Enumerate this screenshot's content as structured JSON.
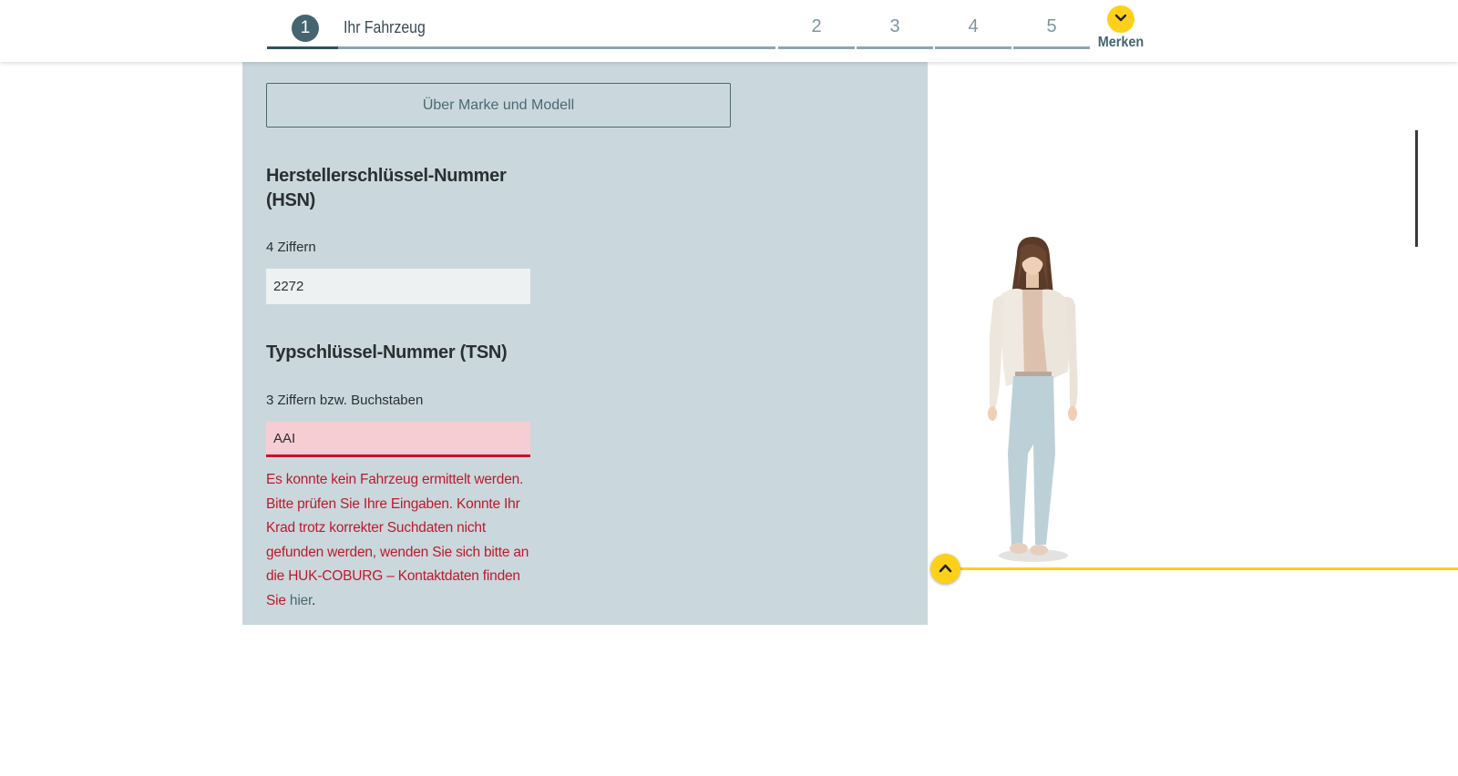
{
  "stepper": {
    "active_number": "1",
    "active_label": "Ihr Fahrzeug",
    "steps": [
      "2",
      "3",
      "4",
      "5"
    ],
    "merken_label": "Merken"
  },
  "form": {
    "brand_button_label": "Über Marke und Modell",
    "hsn": {
      "title": "Herstellerschlüssel-Nummer (HSN)",
      "hint": "4 Ziffern",
      "value": "2272"
    },
    "tsn": {
      "title": "Typschlüssel-Nummer (TSN)",
      "hint": "3 Ziffern bzw. Buchstaben",
      "value": "AAI",
      "error_text": "Es konnte kein Fahrzeug ermittelt werden. Bitte prüfen Sie Ihre Eingaben. Konnte Ihr Krad trotz korrekter Suchdaten nicht gefunden werden, wenden Sie sich bitte an die HUK-COBURG – Kontaktdaten finden Sie ",
      "error_link": "hier",
      "error_end": "."
    }
  },
  "colors": {
    "accent_yellow": "#ffd01a",
    "panel_bg": "#cad8dd",
    "error_red": "#c0182b",
    "step_active": "#44646f"
  },
  "icons": {
    "merken": "chevron-down-icon",
    "scroll": "chevron-up-icon"
  }
}
